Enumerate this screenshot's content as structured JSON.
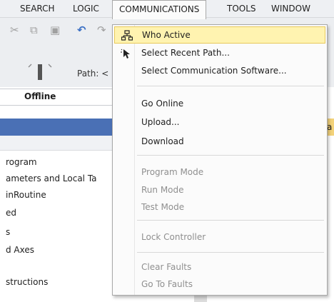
{
  "menubar": {
    "items": [
      "SEARCH",
      "LOGIC",
      "COMMUNICATIONS",
      "TOOLS",
      "WINDOW"
    ]
  },
  "toolbar": {
    "path_label": "Path: <"
  },
  "status": {
    "offline_label": "Offline"
  },
  "tree": {
    "items": [
      "rogram",
      "ameters and Local Ta",
      "inRoutine",
      "ed",
      "s",
      "d Axes",
      "structions"
    ]
  },
  "right_panel": {
    "chip_text": "a"
  },
  "communications_menu": {
    "items": [
      {
        "label": "Who Active",
        "enabled": true,
        "icon": "network-icon",
        "highlighted": true
      },
      {
        "label": "Select Recent Path...",
        "enabled": true,
        "icon": "cursor-arrow-icon"
      },
      {
        "label": "Select Communication Software...",
        "enabled": true
      },
      {
        "label": "Go Online",
        "enabled": true
      },
      {
        "label": "Upload...",
        "enabled": true
      },
      {
        "label": "Download",
        "enabled": true
      },
      {
        "label": "Program Mode",
        "enabled": false
      },
      {
        "label": "Run Mode",
        "enabled": false
      },
      {
        "label": "Test Mode",
        "enabled": false
      },
      {
        "label": "Lock Controller",
        "enabled": false
      },
      {
        "label": "Clear Faults",
        "enabled": false
      },
      {
        "label": "Go To Faults",
        "enabled": false
      }
    ]
  },
  "colors": {
    "highlight_bg": "#fff3b0",
    "highlight_border": "#e8c95a",
    "title_blue": "#4a70b5",
    "disabled_text": "#8f8f8f"
  }
}
